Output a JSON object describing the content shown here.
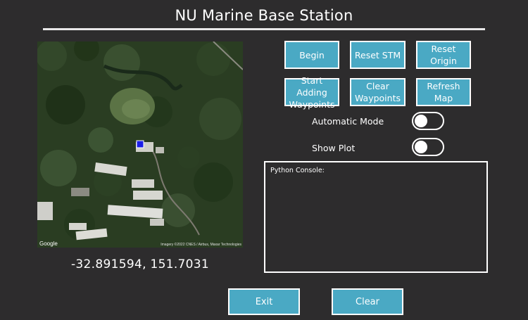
{
  "app": {
    "title": "NU Marine Base Station"
  },
  "map": {
    "google_logo": "Google",
    "attribution": "Imagery ©2022 CNES / Airbus, Maxar Technologies",
    "marker_color": "#1b1ee8",
    "coordinates": "-32.891594, 151.7031"
  },
  "buttons": {
    "begin": "Begin",
    "reset_stm": "Reset STM",
    "reset_origin": "Reset Origin",
    "start_adding_waypoints": "Start Adding Waypoints",
    "clear_waypoints": "Clear Waypoints",
    "refresh_map": "Refresh Map",
    "exit": "Exit",
    "clear": "Clear"
  },
  "toggles": {
    "automatic_mode": {
      "label": "Automatic Mode",
      "on": false
    },
    "show_plot": {
      "label": "Show Plot",
      "on": false
    }
  },
  "console": {
    "label": "Python Console:",
    "content": ""
  },
  "colors": {
    "background": "#2d2c2d",
    "button": "#4aa9c4",
    "button_border": "#ffffff"
  }
}
